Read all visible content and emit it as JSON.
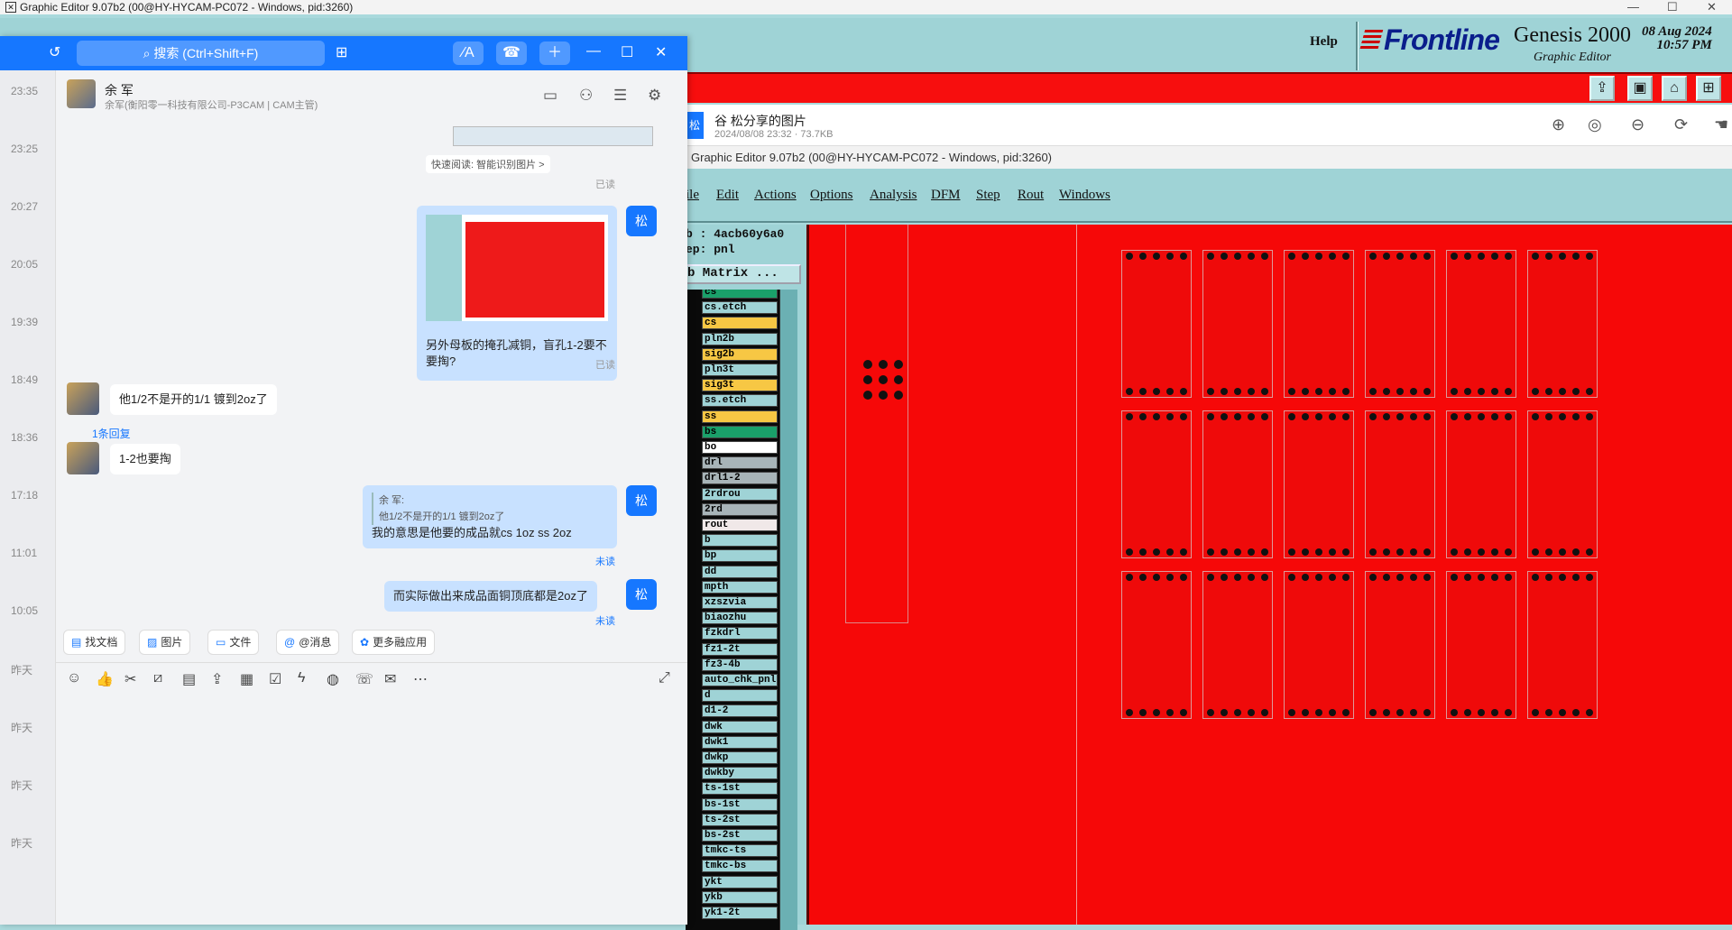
{
  "os_window": {
    "title": "Graphic Editor 9.07b2 (00@HY-HYCAM-PC072 - Windows, pid:3260)",
    "minimize": "—",
    "maximize": "☐",
    "close": "✕"
  },
  "genesis": {
    "help": "Help",
    "logo": "Frontline",
    "product": "Genesis 2000",
    "subtitle": "Graphic Editor",
    "date": "08 Aug 2024",
    "time": "10:57 PM",
    "inner_title": "Graphic Editor 9.07b2 (00@HY-HYCAM-PC072 - Windows, pid:3260)",
    "menus": [
      "ile",
      "Edit",
      "Actions",
      "Options",
      "Analysis",
      "DFM",
      "Step",
      "Rout",
      "Windows"
    ],
    "job_line": "b : 4acb60y6a0",
    "step_line": "ep: pnl",
    "matrix_button": "b Matrix ...",
    "layers": [
      {
        "name": "cs",
        "color": "#1aa06a"
      },
      {
        "name": "cs.etch",
        "color": "#9fd3d6"
      },
      {
        "name": "cs",
        "color": "#f7c744"
      },
      {
        "name": "pln2b",
        "color": "#9fd3d6"
      },
      {
        "name": "sig2b",
        "color": "#f7c744"
      },
      {
        "name": "pln3t",
        "color": "#9fd3d6"
      },
      {
        "name": "sig3t",
        "color": "#f7c744"
      },
      {
        "name": "ss.etch",
        "color": "#9fd3d6"
      },
      {
        "name": "ss",
        "color": "#f7c744"
      },
      {
        "name": "bs",
        "color": "#1aa06a"
      },
      {
        "name": "bo",
        "color": "#ffffff"
      },
      {
        "name": "drl",
        "color": "#a8b4b8"
      },
      {
        "name": "drl1-2",
        "color": "#a8b4b8"
      },
      {
        "name": "2rdrou",
        "color": "#9fd3d6"
      },
      {
        "name": "2rd",
        "color": "#a8b4b8"
      },
      {
        "name": "rout",
        "color": "#f0e8e8"
      },
      {
        "name": "b",
        "color": "#9fd3d6"
      },
      {
        "name": "bp",
        "color": "#9fd3d6"
      },
      {
        "name": "dd",
        "color": "#9fd3d6"
      },
      {
        "name": "mpth",
        "color": "#9fd3d6"
      },
      {
        "name": "xzszvia",
        "color": "#9fd3d6"
      },
      {
        "name": "biaozhu",
        "color": "#9fd3d6"
      },
      {
        "name": "fzkdrl",
        "color": "#9fd3d6"
      },
      {
        "name": "fz1-2t",
        "color": "#9fd3d6"
      },
      {
        "name": "fz3-4b",
        "color": "#9fd3d6"
      },
      {
        "name": "auto_chk_pnl",
        "color": "#9fd3d6"
      },
      {
        "name": "d",
        "color": "#9fd3d6"
      },
      {
        "name": "d1-2",
        "color": "#9fd3d6"
      },
      {
        "name": "dwk",
        "color": "#9fd3d6"
      },
      {
        "name": "dwk1",
        "color": "#9fd3d6"
      },
      {
        "name": "dwkp",
        "color": "#9fd3d6"
      },
      {
        "name": "dwkby",
        "color": "#9fd3d6"
      },
      {
        "name": "ts-1st",
        "color": "#9fd3d6"
      },
      {
        "name": "bs-1st",
        "color": "#9fd3d6"
      },
      {
        "name": "ts-2st",
        "color": "#9fd3d6"
      },
      {
        "name": "bs-2st",
        "color": "#9fd3d6"
      },
      {
        "name": "tmkc-ts",
        "color": "#9fd3d6"
      },
      {
        "name": "tmkc-bs",
        "color": "#9fd3d6"
      },
      {
        "name": "ykt",
        "color": "#9fd3d6"
      },
      {
        "name": "ykb",
        "color": "#9fd3d6"
      },
      {
        "name": "yk1-2t",
        "color": "#9fd3d6"
      }
    ]
  },
  "viewer": {
    "avatar": "松",
    "name": "谷 松分享的图片",
    "meta": "2024/08/08 23:32 · 73.7KB"
  },
  "chat": {
    "search_placeholder": "搜索 (Ctrl+Shift+F)",
    "contact_name": "余 军",
    "contact_org": "余军(衡阳零一科技有限公司-P3CAM | CAM主管)",
    "timestamps": [
      "23:35",
      "23:25",
      "20:27",
      "20:05",
      "19:39",
      "18:49",
      "18:36",
      "17:18",
      "11:01",
      "10:05",
      "昨天",
      "昨天",
      "昨天",
      "昨天"
    ],
    "quick_read": "快速阅读: 智能识别图片 >",
    "read_label": "已读",
    "unread_label": "未读",
    "my_avatar": "松",
    "msg1": "另外母板的掩孔减铜，盲孔1-2要不要掏?",
    "msg2": "他1/2不是开的1/1 镀到2oz了",
    "reply_link": "1条回复",
    "msg3": "1-2也要掏",
    "quote_name": "余 军:",
    "quote_text": "他1/2不是开的1/1 镀到2oz了",
    "msg4": "我的意思是他要的成品就cs  1oz    ss   2oz",
    "msg5": "而实际做出来成品面铜顶底都是2oz了",
    "quick_buttons": [
      "找文档",
      "图片",
      "文件",
      "@消息",
      "更多融应用"
    ]
  }
}
